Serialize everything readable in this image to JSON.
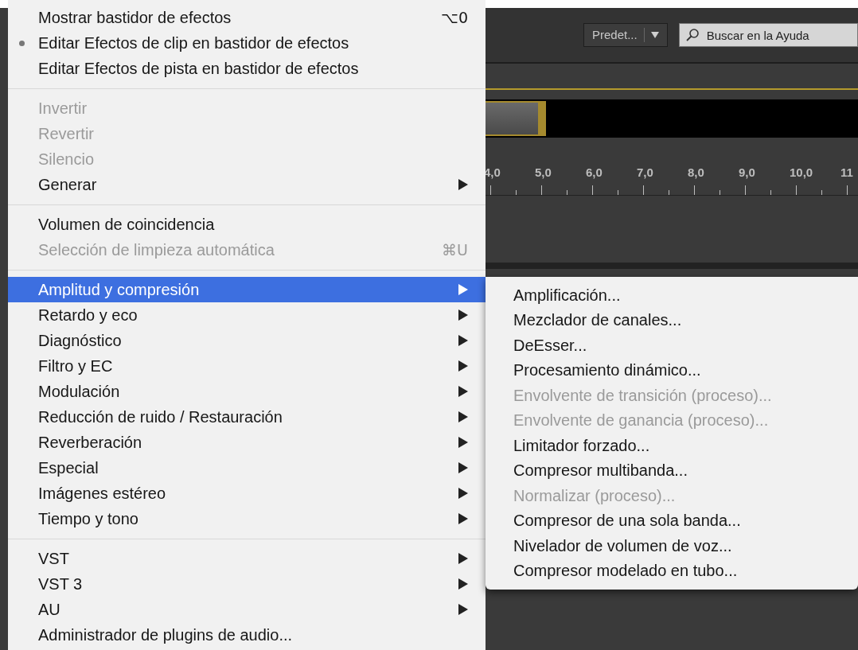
{
  "toolbar": {
    "workspace_button": "Predet...",
    "search": {
      "placeholder": "Buscar en la Ayuda"
    }
  },
  "ruler": {
    "labels": [
      "4,0",
      "5,0",
      "6,0",
      "7,0",
      "8,0",
      "9,0",
      "10,0",
      "11"
    ]
  },
  "menu": {
    "items": [
      {
        "kind": "item",
        "label": "Mostrar bastidor de efectos",
        "shortcut": "⌥0",
        "checked": false,
        "disabled": false,
        "submenu": false,
        "selected": false
      },
      {
        "kind": "item",
        "label": "Editar Efectos de clip en bastidor de efectos",
        "checked": true,
        "disabled": false,
        "submenu": false,
        "selected": false
      },
      {
        "kind": "item",
        "label": "Editar Efectos de pista en bastidor de efectos",
        "checked": false,
        "disabled": false,
        "submenu": false,
        "selected": false
      },
      {
        "kind": "separator"
      },
      {
        "kind": "item",
        "label": "Invertir",
        "checked": false,
        "disabled": true,
        "submenu": false,
        "selected": false
      },
      {
        "kind": "item",
        "label": "Revertir",
        "checked": false,
        "disabled": true,
        "submenu": false,
        "selected": false
      },
      {
        "kind": "item",
        "label": "Silencio",
        "checked": false,
        "disabled": true,
        "submenu": false,
        "selected": false
      },
      {
        "kind": "item",
        "label": "Generar",
        "checked": false,
        "disabled": false,
        "submenu": true,
        "selected": false
      },
      {
        "kind": "separator"
      },
      {
        "kind": "item",
        "label": "Volumen de coincidencia",
        "checked": false,
        "disabled": false,
        "submenu": false,
        "selected": false
      },
      {
        "kind": "item",
        "label": "Selección de limpieza automática",
        "shortcut": "⌘U",
        "checked": false,
        "disabled": true,
        "submenu": false,
        "selected": false
      },
      {
        "kind": "separator"
      },
      {
        "kind": "item",
        "label": "Amplitud y compresión",
        "checked": false,
        "disabled": false,
        "submenu": true,
        "selected": true
      },
      {
        "kind": "item",
        "label": "Retardo y eco",
        "checked": false,
        "disabled": false,
        "submenu": true,
        "selected": false
      },
      {
        "kind": "item",
        "label": "Diagnóstico",
        "checked": false,
        "disabled": false,
        "submenu": true,
        "selected": false
      },
      {
        "kind": "item",
        "label": "Filtro y EC",
        "checked": false,
        "disabled": false,
        "submenu": true,
        "selected": false
      },
      {
        "kind": "item",
        "label": "Modulación",
        "checked": false,
        "disabled": false,
        "submenu": true,
        "selected": false
      },
      {
        "kind": "item",
        "label": "Reducción de ruido / Restauración",
        "checked": false,
        "disabled": false,
        "submenu": true,
        "selected": false
      },
      {
        "kind": "item",
        "label": "Reverberación",
        "checked": false,
        "disabled": false,
        "submenu": true,
        "selected": false
      },
      {
        "kind": "item",
        "label": "Especial",
        "checked": false,
        "disabled": false,
        "submenu": true,
        "selected": false
      },
      {
        "kind": "item",
        "label": "Imágenes estéreo",
        "checked": false,
        "disabled": false,
        "submenu": true,
        "selected": false
      },
      {
        "kind": "item",
        "label": "Tiempo y tono",
        "checked": false,
        "disabled": false,
        "submenu": true,
        "selected": false
      },
      {
        "kind": "separator"
      },
      {
        "kind": "item",
        "label": "VST",
        "checked": false,
        "disabled": false,
        "submenu": true,
        "selected": false
      },
      {
        "kind": "item",
        "label": "VST 3",
        "checked": false,
        "disabled": false,
        "submenu": true,
        "selected": false
      },
      {
        "kind": "item",
        "label": "AU",
        "checked": false,
        "disabled": false,
        "submenu": true,
        "selected": false
      },
      {
        "kind": "item",
        "label": "Administrador de plugins de audio...",
        "checked": false,
        "disabled": false,
        "submenu": false,
        "selected": false
      }
    ]
  },
  "submenu": {
    "items": [
      {
        "label": "Amplificación...",
        "disabled": false
      },
      {
        "label": "Mezclador de canales...",
        "disabled": false
      },
      {
        "label": "DeEsser...",
        "disabled": false
      },
      {
        "label": "Procesamiento dinámico...",
        "disabled": false
      },
      {
        "label": "Envolvente de transición (proceso)...",
        "disabled": true
      },
      {
        "label": "Envolvente de ganancia (proceso)...",
        "disabled": true
      },
      {
        "label": "Limitador forzado...",
        "disabled": false
      },
      {
        "label": "Compresor multibanda...",
        "disabled": false
      },
      {
        "label": "Normalizar (proceso)...",
        "disabled": true
      },
      {
        "label": "Compresor de una sola banda...",
        "disabled": false
      },
      {
        "label": "Nivelador de volumen de voz...",
        "disabled": false
      },
      {
        "label": "Compresor modelado en tubo...",
        "disabled": false
      }
    ]
  }
}
